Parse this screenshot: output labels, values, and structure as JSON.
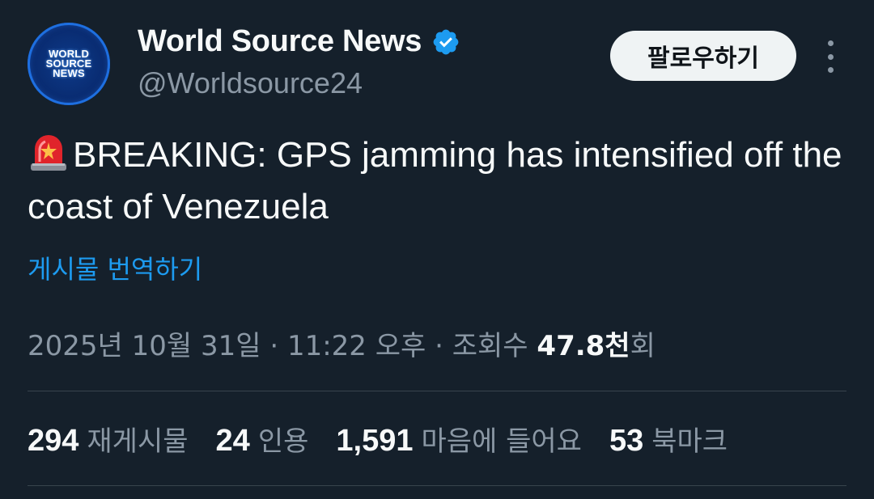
{
  "author": {
    "display_name": "World Source News",
    "handle": "@Worldsource24",
    "avatar_text": [
      "WORLD",
      "SOURCE",
      "NEWS"
    ],
    "verified_icon": "verified-badge-icon"
  },
  "follow_button_label": "팔로우하기",
  "more_icon": "more-options-icon",
  "tweet": {
    "emoji": "🚨",
    "text": "BREAKING: GPS jamming has intensified off the coast of Venezuela"
  },
  "translate_link": "게시물 번역하기",
  "meta": {
    "date": "2025년 10월 31일",
    "separator": " · ",
    "time": "11:22 오후",
    "views_label": "조회수",
    "views_count": "47.8천",
    "views_suffix": "회"
  },
  "stats": [
    {
      "count": "294",
      "label": "재게시물"
    },
    {
      "count": "24",
      "label": "인용"
    },
    {
      "count": "1,591",
      "label": "마음에 들어요"
    },
    {
      "count": "53",
      "label": "북마크"
    }
  ],
  "colors": {
    "background": "#15202b",
    "accent": "#1d9bf0",
    "secondary_text": "#8b98a5"
  }
}
